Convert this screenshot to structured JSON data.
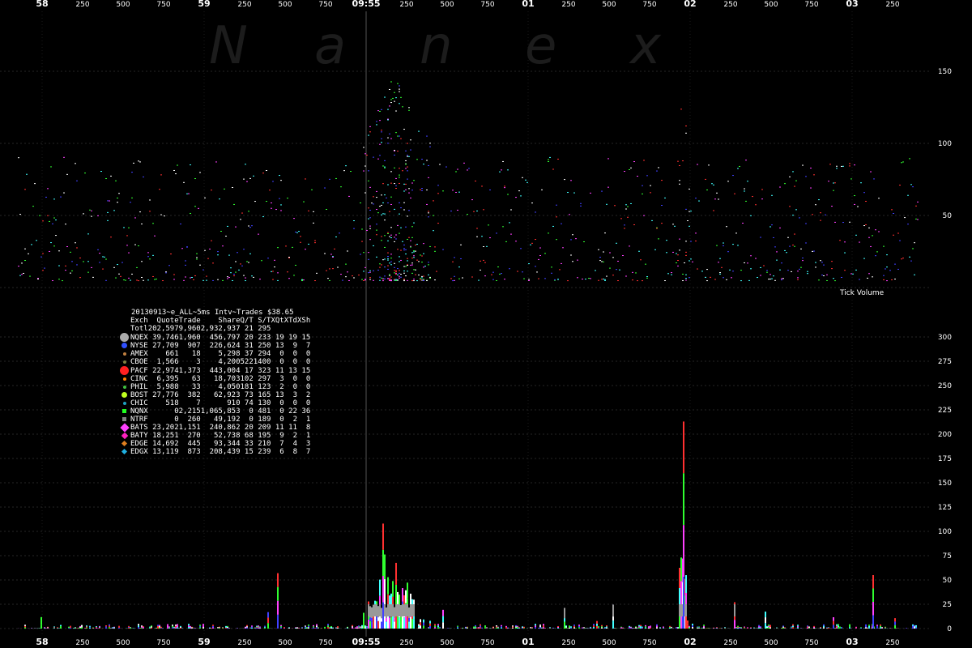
{
  "chart_data": {
    "title": "20130913~e_ALL~5ms Intv~Trades $38.65",
    "watermark": "Nanex",
    "time_axis": {
      "labels": [
        "58",
        "250",
        "500",
        "750",
        "59",
        "250",
        "500",
        "750",
        "09:55",
        "250",
        "500",
        "750",
        "01",
        "250",
        "500",
        "750",
        "02",
        "250",
        "500",
        "750",
        "03",
        "250"
      ],
      "major": [
        "58",
        "59",
        "09:55",
        "01",
        "02",
        "03"
      ]
    },
    "top_panel": {
      "type": "scatter",
      "ylabel": "Tick Volume",
      "yticks": [
        50,
        100,
        150
      ],
      "series_colors": [
        "#ff3030",
        "#30ff30",
        "#4040ff",
        "#ff40ff",
        "#ffffff",
        "#40ffff"
      ],
      "description_points": "dense dots between 0-100, spikes near 09:55 and 02"
    },
    "bottom_panel": {
      "type": "bar",
      "yticks": [
        0,
        25,
        50,
        75,
        100,
        125,
        150,
        175,
        200,
        225,
        250,
        275,
        300
      ],
      "spikes": [
        {
          "x_label": "09:55+",
          "value": 108
        },
        {
          "x_label": "02",
          "value": 213
        },
        {
          "x_label": "500 (59)",
          "value": 57
        },
        {
          "x_label": "03+",
          "value": 55
        }
      ]
    },
    "legend": {
      "columns": [
        "Exch",
        "Quote",
        "Trade",
        "Share",
        "Q/T",
        "S/T",
        "XQt",
        "XTd",
        "XSh"
      ],
      "total": {
        "name": "Totl",
        "quote": "202,597",
        "trade": "9,960",
        "share": "2,932,937",
        "qt": "21",
        "st": "295",
        "xqt": "",
        "xtd": "",
        "xsh": ""
      },
      "rows": [
        {
          "name": "NQEX",
          "color": "#aaaaaa",
          "shape": "big-dot",
          "quote": "39,746",
          "trade": "1,960",
          "share": "456,797",
          "qt": "20",
          "st": "233",
          "xqt": "19",
          "xtd": "19",
          "xsh": "15"
        },
        {
          "name": "NYSE",
          "color": "#3050ff",
          "shape": "dot",
          "quote": "27,709",
          "trade": "907",
          "share": "226,624",
          "qt": "31",
          "st": "250",
          "xqt": "13",
          "xtd": "9",
          "xsh": "7"
        },
        {
          "name": "AMEX",
          "color": "#c08040",
          "shape": "small-dot",
          "quote": "661",
          "trade": "18",
          "share": "5,298",
          "qt": "37",
          "st": "294",
          "xqt": "0",
          "xtd": "0",
          "xsh": "0"
        },
        {
          "name": "CBOE",
          "color": "#808040",
          "shape": "small-dot",
          "quote": "1,566",
          "trade": "3",
          "share": "4,200",
          "qt": "522",
          "st": "1400",
          "xqt": "0",
          "xtd": "0",
          "xsh": "0"
        },
        {
          "name": "PACF",
          "color": "#ff2020",
          "shape": "big-dot",
          "quote": "22,974",
          "trade": "1,373",
          "share": "443,004",
          "qt": "17",
          "st": "323",
          "xqt": "11",
          "xtd": "13",
          "xsh": "15"
        },
        {
          "name": "CINC",
          "color": "#ff8000",
          "shape": "small-dot",
          "quote": "6,395",
          "trade": "63",
          "share": "18,703",
          "qt": "102",
          "st": "297",
          "xqt": "3",
          "xtd": "0",
          "xsh": "0"
        },
        {
          "name": "PHIL",
          "color": "#40c040",
          "shape": "small-dot",
          "quote": "5,988",
          "trade": "33",
          "share": "4,050",
          "qt": "181",
          "st": "123",
          "xqt": "2",
          "xtd": "0",
          "xsh": "0"
        },
        {
          "name": "BOST",
          "color": "#c0ff20",
          "shape": "dot",
          "quote": "27,776",
          "trade": "382",
          "share": "62,923",
          "qt": "73",
          "st": "165",
          "xqt": "13",
          "xtd": "3",
          "xsh": "2"
        },
        {
          "name": "CHIC",
          "color": "#20a0c0",
          "shape": "small-dot",
          "quote": "518",
          "trade": "7",
          "share": "910",
          "qt": "74",
          "st": "130",
          "xqt": "0",
          "xtd": "0",
          "xsh": "0"
        },
        {
          "name": "NQNX",
          "color": "#20ff20",
          "shape": "square",
          "quote": "0",
          "trade": "2,215",
          "share": "1,065,853",
          "qt": "0",
          "st": "481",
          "xqt": "0",
          "xtd": "22",
          "xsh": "36"
        },
        {
          "name": "NTRF",
          "color": "#808080",
          "shape": "square",
          "quote": "0",
          "trade": "260",
          "share": "49,192",
          "qt": "0",
          "st": "189",
          "xqt": "0",
          "xtd": "2",
          "xsh": "1"
        },
        {
          "name": "BATS",
          "color": "#ff40ff",
          "shape": "big-diamond",
          "quote": "23,202",
          "trade": "1,151",
          "share": "240,862",
          "qt": "20",
          "st": "209",
          "xqt": "11",
          "xtd": "11",
          "xsh": "8"
        },
        {
          "name": "BATY",
          "color": "#ff20c0",
          "shape": "diamond",
          "quote": "18,251",
          "trade": "270",
          "share": "52,738",
          "qt": "68",
          "st": "195",
          "xqt": "9",
          "xtd": "2",
          "xsh": "1"
        },
        {
          "name": "EDGE",
          "color": "#e08020",
          "shape": "small-diamond",
          "quote": "14,692",
          "trade": "445",
          "share": "93,344",
          "qt": "33",
          "st": "210",
          "xqt": "7",
          "xtd": "4",
          "xsh": "3"
        },
        {
          "name": "EDGX",
          "color": "#20b0e0",
          "shape": "small-diamond",
          "quote": "13,119",
          "trade": "873",
          "share": "208,439",
          "qt": "15",
          "st": "239",
          "xqt": "6",
          "xtd": "8",
          "xsh": "7"
        }
      ]
    }
  }
}
